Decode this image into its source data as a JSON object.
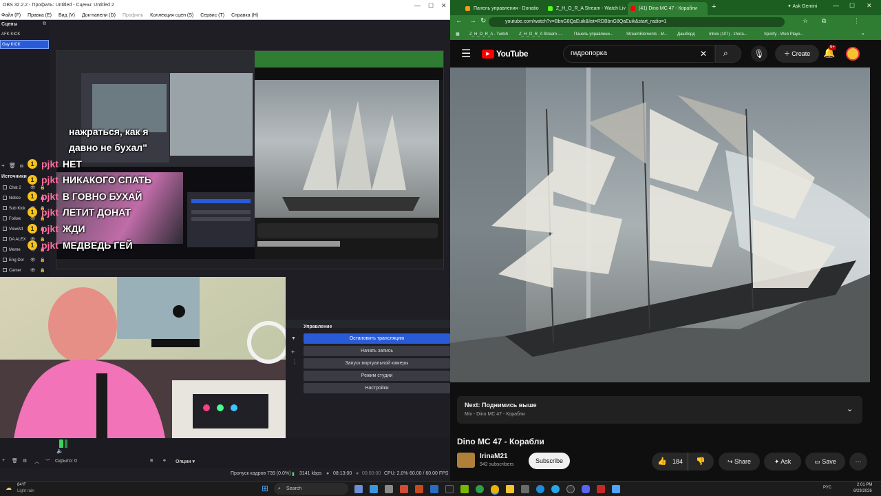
{
  "obs": {
    "title": "OBS 32.2.2 - Профиль: Untitled - Сцены: Untitled 2",
    "menu": [
      "Файл (F)",
      "Правка (E)",
      "Вид (V)",
      "Док-панели (D)",
      "Профиль",
      "Коллекция сцен (S)",
      "Сервис (T)",
      "Справка (H)"
    ],
    "scenes_title": "Сцены",
    "scenes": [
      "AFK KICK",
      "Gay KICK"
    ],
    "sources_title": "Источники",
    "sources": [
      "Chat 2",
      "Notice",
      "Sub Kick",
      "Follow",
      "ViewAtt",
      "DA ALEX",
      "Meme",
      "Eng Dor",
      "Camer"
    ],
    "controls_title": "Управление",
    "controls": [
      "Остановить трансляцию",
      "Начать запись",
      "Запуск виртуальной камеры",
      "Режим студии",
      "Настройки"
    ],
    "hidden_label": "Скрыто: 0",
    "options_label": "Опции",
    "status": {
      "dropped": "Пропуск кадров 739 (0.0%)",
      "bitrate": "3141 kbps",
      "time_live": "08:13:00",
      "time_rec": "00:00:00",
      "cpu": "CPU: 2.0%",
      "fps": "60.00 / 60.00 FPS"
    },
    "chat": [
      {
        "user": "",
        "text": "нажраться, как я"
      },
      {
        "user": "",
        "text": "давно не бухал\""
      },
      {
        "user": "pjkt",
        "text": "НЕТ"
      },
      {
        "user": "pjkt",
        "text": "НИКАКОГО СПАТЬ"
      },
      {
        "user": "pjkt",
        "text": "В ГОВНО БУХАЙ"
      },
      {
        "user": "pjkt",
        "text": "ЛЕТИТ ДОНАТ"
      },
      {
        "user": "pjkt",
        "text": "ЖДИ"
      },
      {
        "user": "pjkt",
        "text": "МЕДВЕДЬ ГЕЙ"
      }
    ],
    "chat_badge": "1"
  },
  "browser": {
    "tabs": [
      "Панель управления - Donatio",
      "Z_H_O_R_A Stream - Watch Liv",
      "(41) Dino MC 47 - Корабли"
    ],
    "ask_gemini": "Ask Gemini",
    "url": "youtube.com/watch?v=BbnG8QaEuik&list=RDBbnG8QaEuik&start_radio=1",
    "bookmarks": [
      "Z_H_O_R_A - Twitch",
      "Z_H_O_R_A Stream -...",
      "Панель управлени...",
      "StreamElements - M...",
      "Дашборд",
      "Inbox (107) - zhora...",
      "Spotify - Web Playe..."
    ]
  },
  "youtube": {
    "logo": "YouTube",
    "search": "гидропорка",
    "create": "Create",
    "notif": "9+",
    "next_label": "Next: Поднимись выше",
    "next_sub": "Mix - Dino MC 47 - Корабли",
    "video_title": "Dino MC 47 - Корабли",
    "channel": "IrinaM21",
    "subscribers": "942 subscribers",
    "subscribe": "Subscribe",
    "likes": "184",
    "share": "Share",
    "ask": "Ask",
    "save": "Save"
  },
  "taskbar": {
    "weather_temp": "84°F",
    "weather_desc": "Light rain",
    "search": "Search",
    "lang": "РУС",
    "time": "2:01 PM",
    "date": "8/29/2026"
  }
}
